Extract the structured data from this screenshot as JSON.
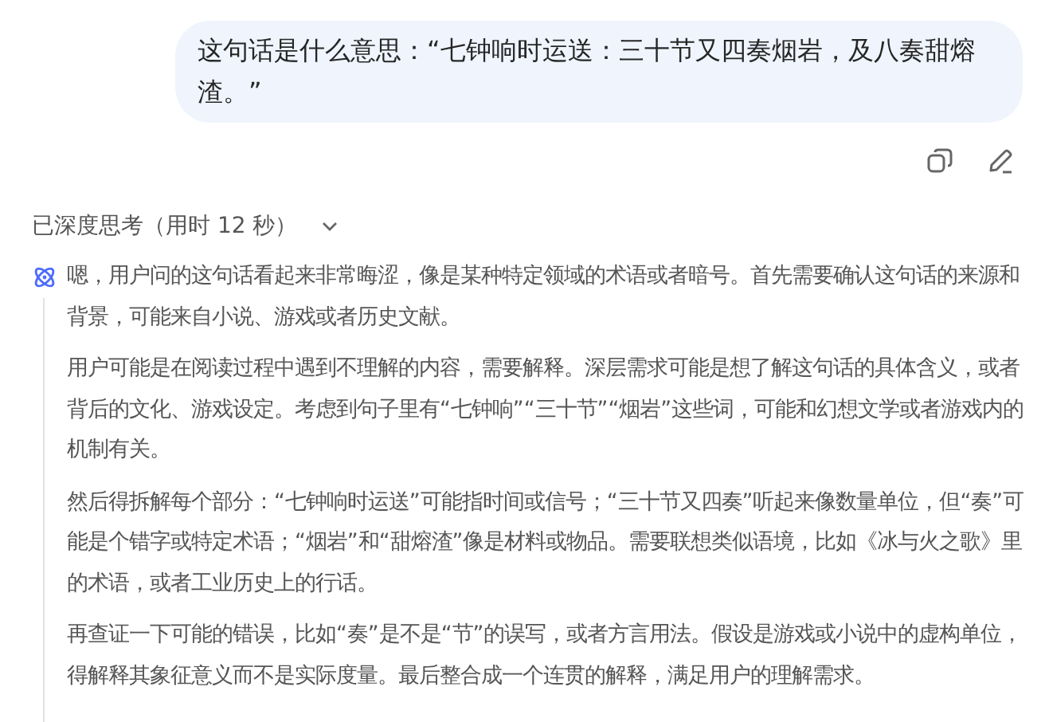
{
  "user_message": {
    "text": "这句话是什么意思：“七钟响时运送：三十节又四奏烟岩，及八奏甜熔渣。”"
  },
  "message_actions": [
    {
      "kind": "copy"
    },
    {
      "kind": "edit"
    }
  ],
  "thinking": {
    "header": "已深度思考（用时 12 秒）",
    "expanded": true,
    "paragraphs": [
      "嗯，用户问的这句话看起来非常晦涩，像是某种特定领域的术语或者暗号。首先需要确认这句话的来源和背景，可能来自小说、游戏或者历史文献。",
      "用户可能是在阅读过程中遇到不理解的内容，需要解释。深层需求可能是想了解这句话的具体含义，或者背后的文化、游戏设定。考虑到句子里有“七钟响”“三十节”“烟岩”这些词，可能和幻想文学或者游戏内的机制有关。",
      "然后得拆解每个部分：“七钟响时运送”可能指时间或信号；“三十节又四奏”听起来像数量单位，但“奏”可能是个错字或特定术语；“烟岩”和“甜熔渣”像是材料或物品。需要联想类似语境，比如《冰与火之歌》里的术语，或者工业历史上的行话。",
      "再查证一下可能的错误，比如“奏”是不是“节”的误写，或者方言用法。假设是游戏或小说中的虚构单位，得解释其象征意义而不是实际度量。最后整合成一个连贯的解释，满足用户的理解需求。"
    ]
  }
}
